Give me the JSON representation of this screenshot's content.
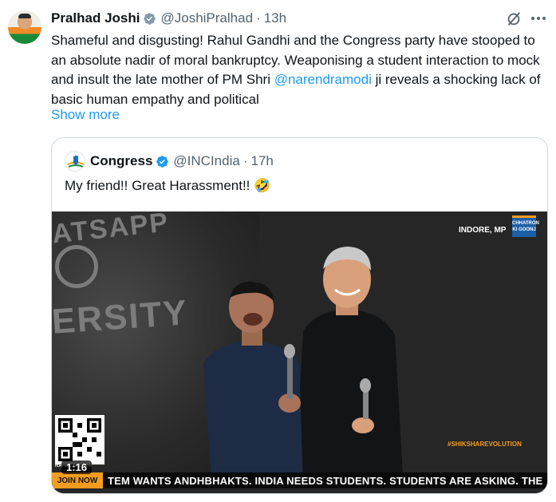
{
  "tweet": {
    "author_name": "Pralhad Joshi",
    "handle": "@JoshiPralhad",
    "separator": "·",
    "time": "13h",
    "text_before_mention": "Shameful and disgusting! Rahul Gandhi and the Congress party have stooped to an absolute nadir of moral bankruptcy. Weaponising a student interaction to mock and insult the late mother of PM Shri ",
    "mention": "@narendramodi",
    "text_after_mention": " ji reveals a shocking lack of basic human empathy and political",
    "show_more": "Show more"
  },
  "quoted": {
    "author_name": "Congress",
    "handle": "@INCIndia",
    "separator": "·",
    "time": "17h",
    "text": "My friend!! Great Harassment!! 🤣",
    "video": {
      "duration": "1:16",
      "location_tag": "INDORE, MP",
      "brand_tag": "CHHATRON KI GOONJ",
      "hashtag": "#SHIKSHAREVOLUTION",
      "join_label": "JOIN NOW",
      "ticker": "TEM WANTS ANDHBHAKTS. INDIA NEEDS STUDENTS.    STUDENTS ARE ASKING. THE",
      "qr_label": "RAHUL GANDHI",
      "bg_text_top": "ATSAPP",
      "bg_text_bottom": "ERSITY"
    }
  },
  "colors": {
    "accent": "#1d9bf0",
    "secondary_text": "#536471",
    "verified_gray": "#829aab",
    "verified_blue": "#1d9bf0",
    "ticker_orange": "#f39c1d"
  },
  "icons": {
    "author_verified": "verified-badge-gray-icon",
    "quoted_verified": "verified-badge-blue-icon",
    "grok": "grok-icon",
    "more": "more-options-icon"
  }
}
